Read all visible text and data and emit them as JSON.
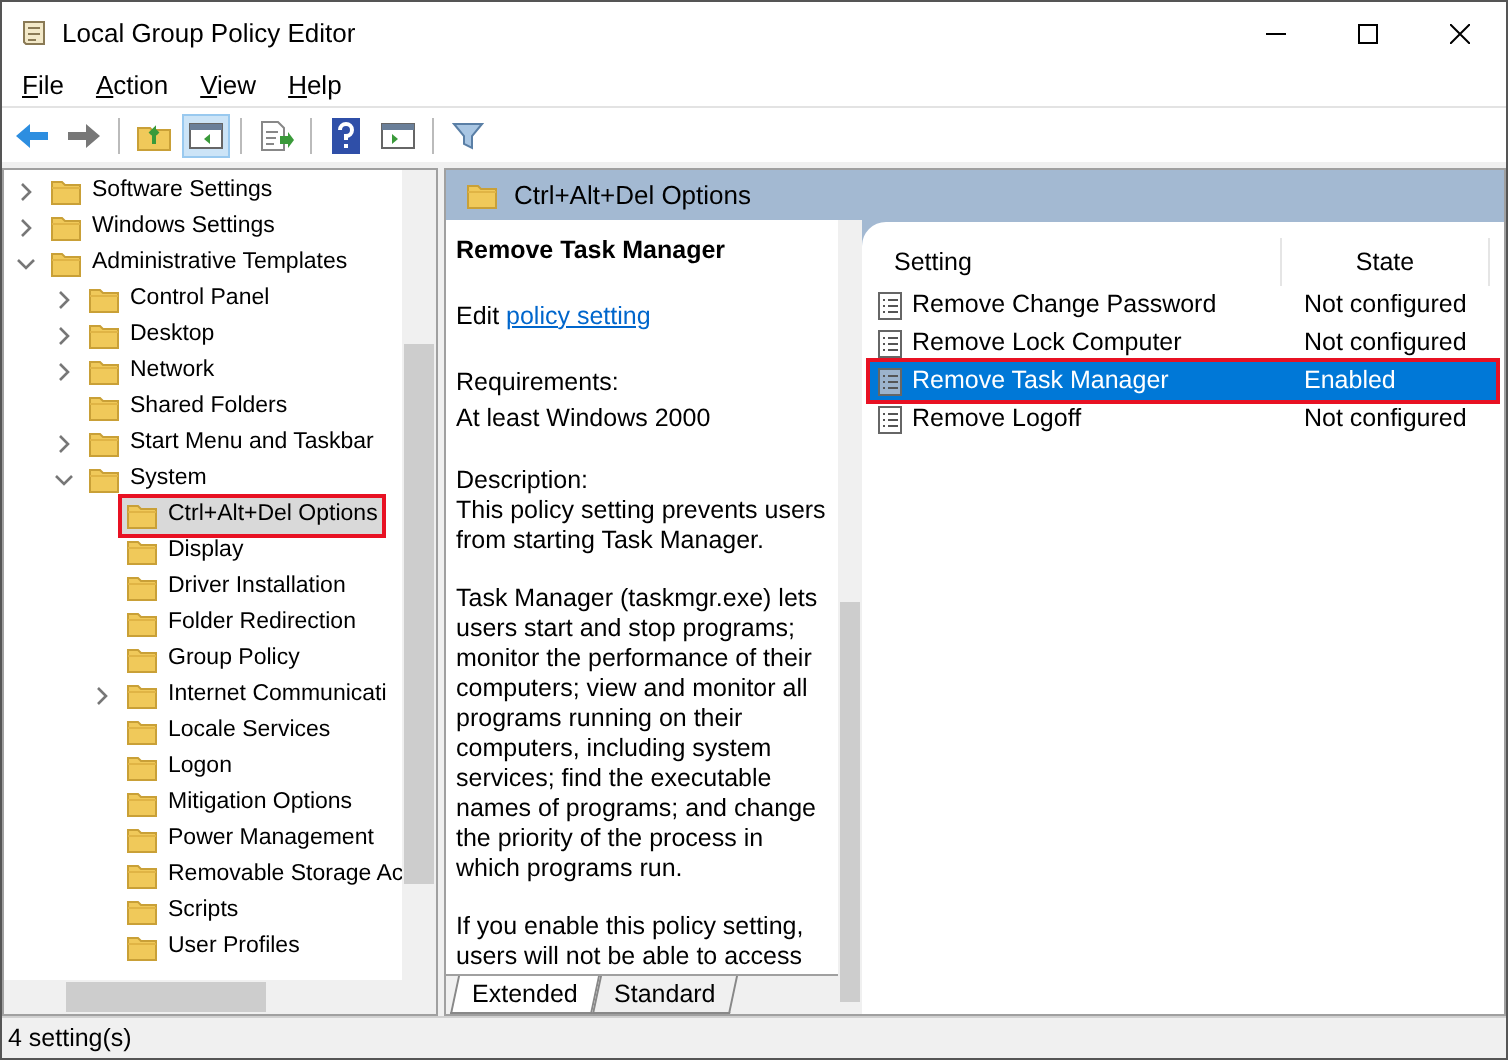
{
  "window": {
    "title": "Local Group Policy Editor"
  },
  "menu": [
    {
      "label": "File"
    },
    {
      "label": "Action"
    },
    {
      "label": "View"
    },
    {
      "label": "Help"
    }
  ],
  "toolbar": [
    {
      "kind": "back",
      "selected": false
    },
    {
      "kind": "forward",
      "selected": false
    },
    {
      "kind": "up",
      "selected": false
    },
    {
      "kind": "tree",
      "selected": true
    },
    {
      "kind": "export",
      "selected": false
    },
    {
      "kind": "help",
      "selected": false
    },
    {
      "kind": "pane",
      "selected": false
    },
    {
      "kind": "filter",
      "selected": false
    }
  ],
  "tree": [
    {
      "label": "Software Settings",
      "expanded": false,
      "selected": false
    },
    {
      "label": "Windows Settings",
      "expanded": false,
      "selected": false
    },
    {
      "label": "Administrative Templates",
      "expanded": true,
      "selected": false,
      "children": [
        {
          "label": "Control Panel",
          "expanded": false,
          "selected": false
        },
        {
          "label": "Desktop",
          "expanded": false,
          "selected": false
        },
        {
          "label": "Network",
          "expanded": false,
          "selected": false
        },
        {
          "label": "Shared Folders",
          "selected": false
        },
        {
          "label": "Start Menu and Taskbar",
          "expanded": false,
          "selected": false
        },
        {
          "label": "System",
          "expanded": true,
          "selected": false,
          "children": [
            {
              "label": "Ctrl+Alt+Del Options",
              "selected": true,
              "highlighted": true
            },
            {
              "label": "Display",
              "selected": false,
              "highlighted": false
            },
            {
              "label": "Driver Installation",
              "selected": false,
              "highlighted": false
            },
            {
              "label": "Folder Redirection",
              "selected": false,
              "highlighted": false
            },
            {
              "label": "Group Policy",
              "selected": false,
              "highlighted": false
            },
            {
              "label": "Internet Communicati",
              "expanded": false,
              "selected": false,
              "highlighted": false
            },
            {
              "label": "Locale Services",
              "selected": false,
              "highlighted": false
            },
            {
              "label": "Logon",
              "selected": false,
              "highlighted": false
            },
            {
              "label": "Mitigation Options",
              "selected": false,
              "highlighted": false
            },
            {
              "label": "Power Management",
              "selected": false,
              "highlighted": false
            },
            {
              "label": "Removable Storage Ac",
              "selected": false,
              "highlighted": false
            },
            {
              "label": "Scripts",
              "selected": false,
              "highlighted": false
            },
            {
              "label": "User Profiles",
              "selected": false,
              "highlighted": false
            }
          ]
        }
      ]
    }
  ],
  "header": {
    "title": "Ctrl+Alt+Del Options"
  },
  "detail": {
    "heading": "Remove Task Manager",
    "edit_prefix": "Edit",
    "edit_link": "policy setting",
    "requirements": [
      "Requirements:",
      "At least Windows 2000"
    ],
    "paragraphs": [
      "Description:\nThis policy setting prevents users from starting Task Manager.",
      "Task Manager (taskmgr.exe) lets users start and stop programs; monitor the performance of their computers; view and monitor all programs running on their computers, including system services; find the executable names of programs; and change the priority of the process in which programs run.",
      "If you enable this policy setting, users will not be able to access"
    ]
  },
  "list": {
    "columns": [
      "Setting",
      "State"
    ],
    "rows": [
      {
        "name": "Remove Change Password",
        "state": "Not configured",
        "selected": false,
        "highlighted": false
      },
      {
        "name": "Remove Lock Computer",
        "state": "Not configured",
        "selected": false,
        "highlighted": false
      },
      {
        "name": "Remove Task Manager",
        "state": "Enabled",
        "selected": true,
        "highlighted": true
      },
      {
        "name": "Remove Logoff",
        "state": "Not configured",
        "selected": false,
        "highlighted": false
      }
    ]
  },
  "tabs": [
    {
      "label": "Extended",
      "selected": true
    },
    {
      "label": "Standard",
      "selected": false
    }
  ],
  "status_bar": "4 setting(s)"
}
